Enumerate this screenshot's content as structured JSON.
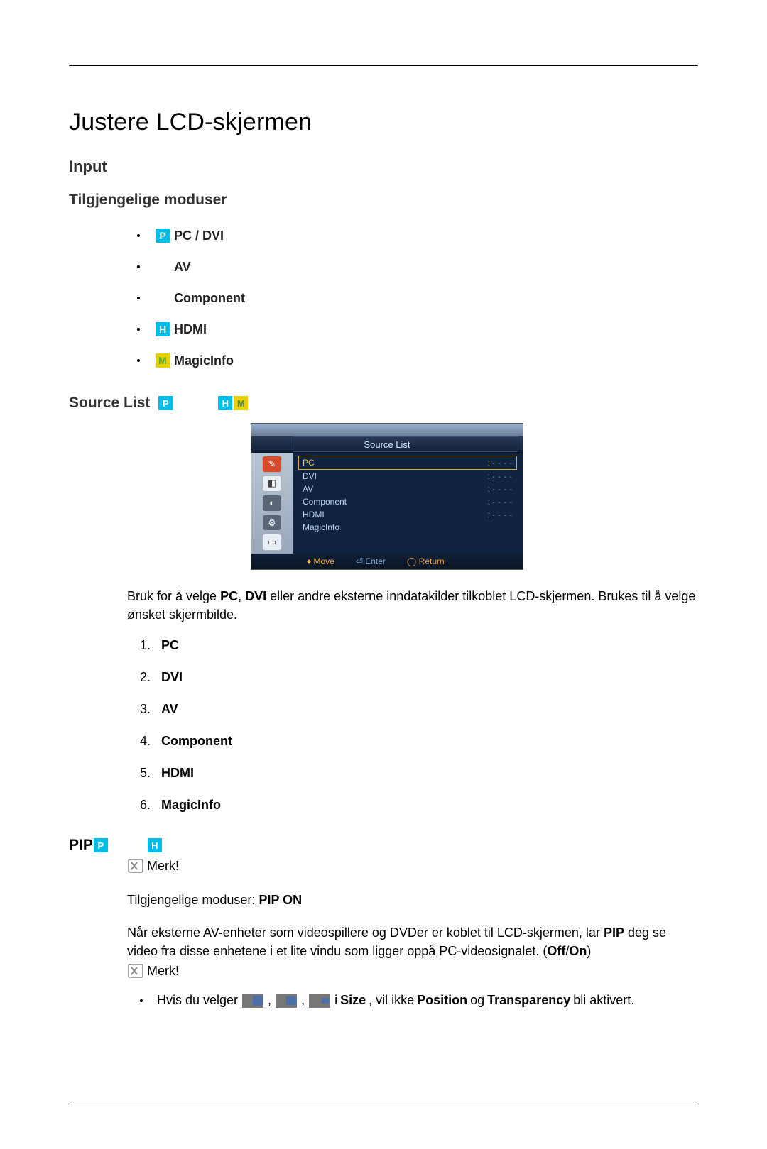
{
  "title": "Justere LCD-skjermen",
  "input_heading": "Input",
  "available_modes_heading": "Tilgjengelige moduser",
  "modes": [
    {
      "icon": "P",
      "icon_class": "pc",
      "label": "PC / DVI"
    },
    {
      "icon": "",
      "icon_class": "blank",
      "label": "AV"
    },
    {
      "icon": "",
      "icon_class": "blank",
      "label": "Component"
    },
    {
      "icon": "H",
      "icon_class": "hdmi",
      "label": "HDMI"
    },
    {
      "icon": "M",
      "icon_class": "minfo",
      "label": "MagicInfo"
    }
  ],
  "source_list_heading": "Source List",
  "osd": {
    "title": "Source List",
    "items": [
      {
        "label": "PC",
        "value": "- - - -",
        "selected": true
      },
      {
        "label": "DVI",
        "value": "- - - -"
      },
      {
        "label": "AV",
        "value": "- - - -"
      },
      {
        "label": "Component",
        "value": "- - - -"
      },
      {
        "label": "HDMI",
        "value": "- - - -"
      },
      {
        "label": "MagicInfo",
        "value": ""
      }
    ],
    "footer": {
      "move": "Move",
      "enter": "Enter",
      "return": "Return"
    }
  },
  "source_desc_pre": "Bruk for å velge ",
  "source_desc_bold1": "PC",
  "source_desc_mid1": ", ",
  "source_desc_bold2": "DVI",
  "source_desc_post": " eller andre eksterne inndatakilder tilkoblet LCD-skjermen. Brukes til å velge ønsket skjermbilde.",
  "numbered": [
    {
      "n": "1.",
      "t": "PC"
    },
    {
      "n": "2.",
      "t": "DVI"
    },
    {
      "n": "3.",
      "t": "AV"
    },
    {
      "n": "4.",
      "t": "Component"
    },
    {
      "n": "5.",
      "t": "HDMI"
    },
    {
      "n": "6.",
      "t": "MagicInfo"
    }
  ],
  "pip_heading": "PIP",
  "note_label": "Merk!",
  "pip_modes_pre": "Tilgjengelige moduser: ",
  "pip_modes_bold": "PIP ON",
  "pip_desc_p1": "Når eksterne AV-enheter som videospillere og DVDer er koblet til LCD-skjermen, lar ",
  "pip_desc_b1": "PIP",
  "pip_desc_p2": " deg se video fra disse enhetene i et lite vindu som ligger oppå PC-videosignalet. (",
  "pip_desc_b2": "Off",
  "pip_desc_slash": "/",
  "pip_desc_b3": "On",
  "pip_desc_p3": ")",
  "size_note_pre": "Hvis du velger ",
  "size_note_mid": " i ",
  "size_note_b1": "Size",
  "size_note_p2": ", vil ikke ",
  "size_note_b2": "Position",
  "size_note_p3": " og ",
  "size_note_b3": "Transparency",
  "size_note_p4": " bli aktivert.",
  "comma": ", "
}
